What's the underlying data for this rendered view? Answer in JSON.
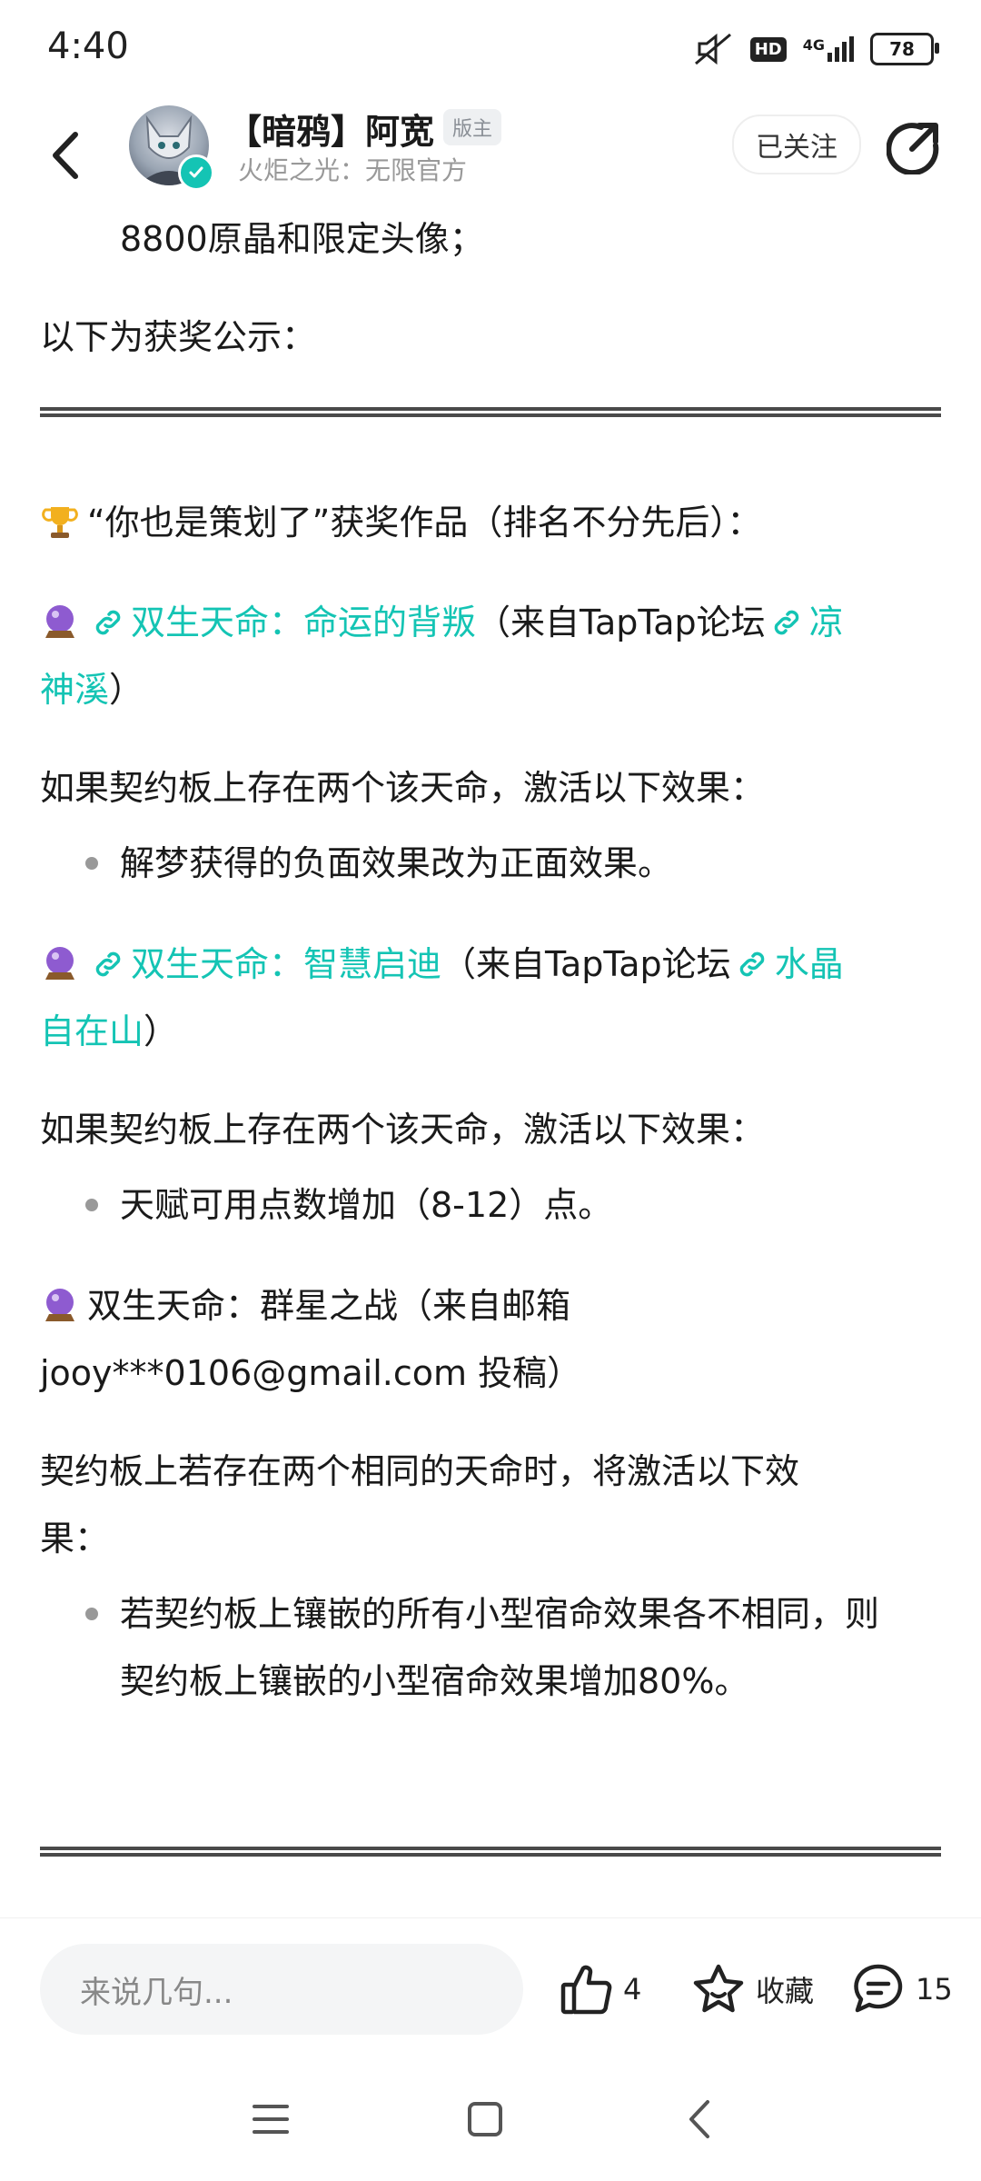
{
  "status_bar": {
    "time": "4:40",
    "network": "4G",
    "hd": "HD",
    "battery": "78"
  },
  "header": {
    "author_name": "【暗鸦】阿宽",
    "moderator_badge": "版主",
    "author_subtitle": "火炬之光：无限官方",
    "follow_label": "已关注"
  },
  "post": {
    "line_prize": "8800原晶和限定头像；",
    "line_announce": "以下为获奖公示：",
    "award_title": "“你也是策划了”获奖作品（排名不分先后）：",
    "entries": [
      {
        "title": "双生天命：命运的背叛",
        "source_prefix": "（来自TapTap论坛",
        "author_part1": "凉",
        "author_part2": "神溪",
        "source_suffix": "）",
        "effect_intro": "如果契约板上存在两个该天命，激活以下效果：",
        "bullet": "解梦获得的负面效果改为正面效果。"
      },
      {
        "title": "双生天命：智慧启迪",
        "source_prefix": "（来自TapTap论坛",
        "author_part1": "水晶",
        "author_part2": "自在山",
        "source_suffix": "）",
        "effect_intro": "如果契约板上存在两个该天命，激活以下效果：",
        "bullet": "天赋可用点数增加（8-12）点。"
      },
      {
        "title_line1": "双生天命：群星之战（来自邮箱",
        "title_line2": "jooy***0106@gmail.com 投稿）",
        "effect_intro_line1": "契约板上若存在两个相同的天命时，将激活以下效",
        "effect_intro_line2": "果：",
        "bullet_line1": "若契约板上镶嵌的所有小型宿命效果各不相同，则",
        "bullet_line2": "契约板上镶嵌的小型宿命效果增加80%。"
      }
    ]
  },
  "bottom_bar": {
    "comment_placeholder": "来说几句...",
    "like_count": "4",
    "favorite_label": "收藏",
    "comment_count": "15"
  },
  "colors": {
    "accent": "#14c4b4",
    "text": "#1a1a1a",
    "secondary_text": "#999999",
    "divider": "#4a4a4a"
  },
  "icons": [
    "back-icon",
    "share-icon",
    "verified-icon",
    "trophy-icon",
    "crystal-ball-icon",
    "link-icon",
    "thumbs-up-icon",
    "star-icon",
    "comment-icon",
    "menu-icon",
    "home-square-icon",
    "nav-back-icon"
  ]
}
